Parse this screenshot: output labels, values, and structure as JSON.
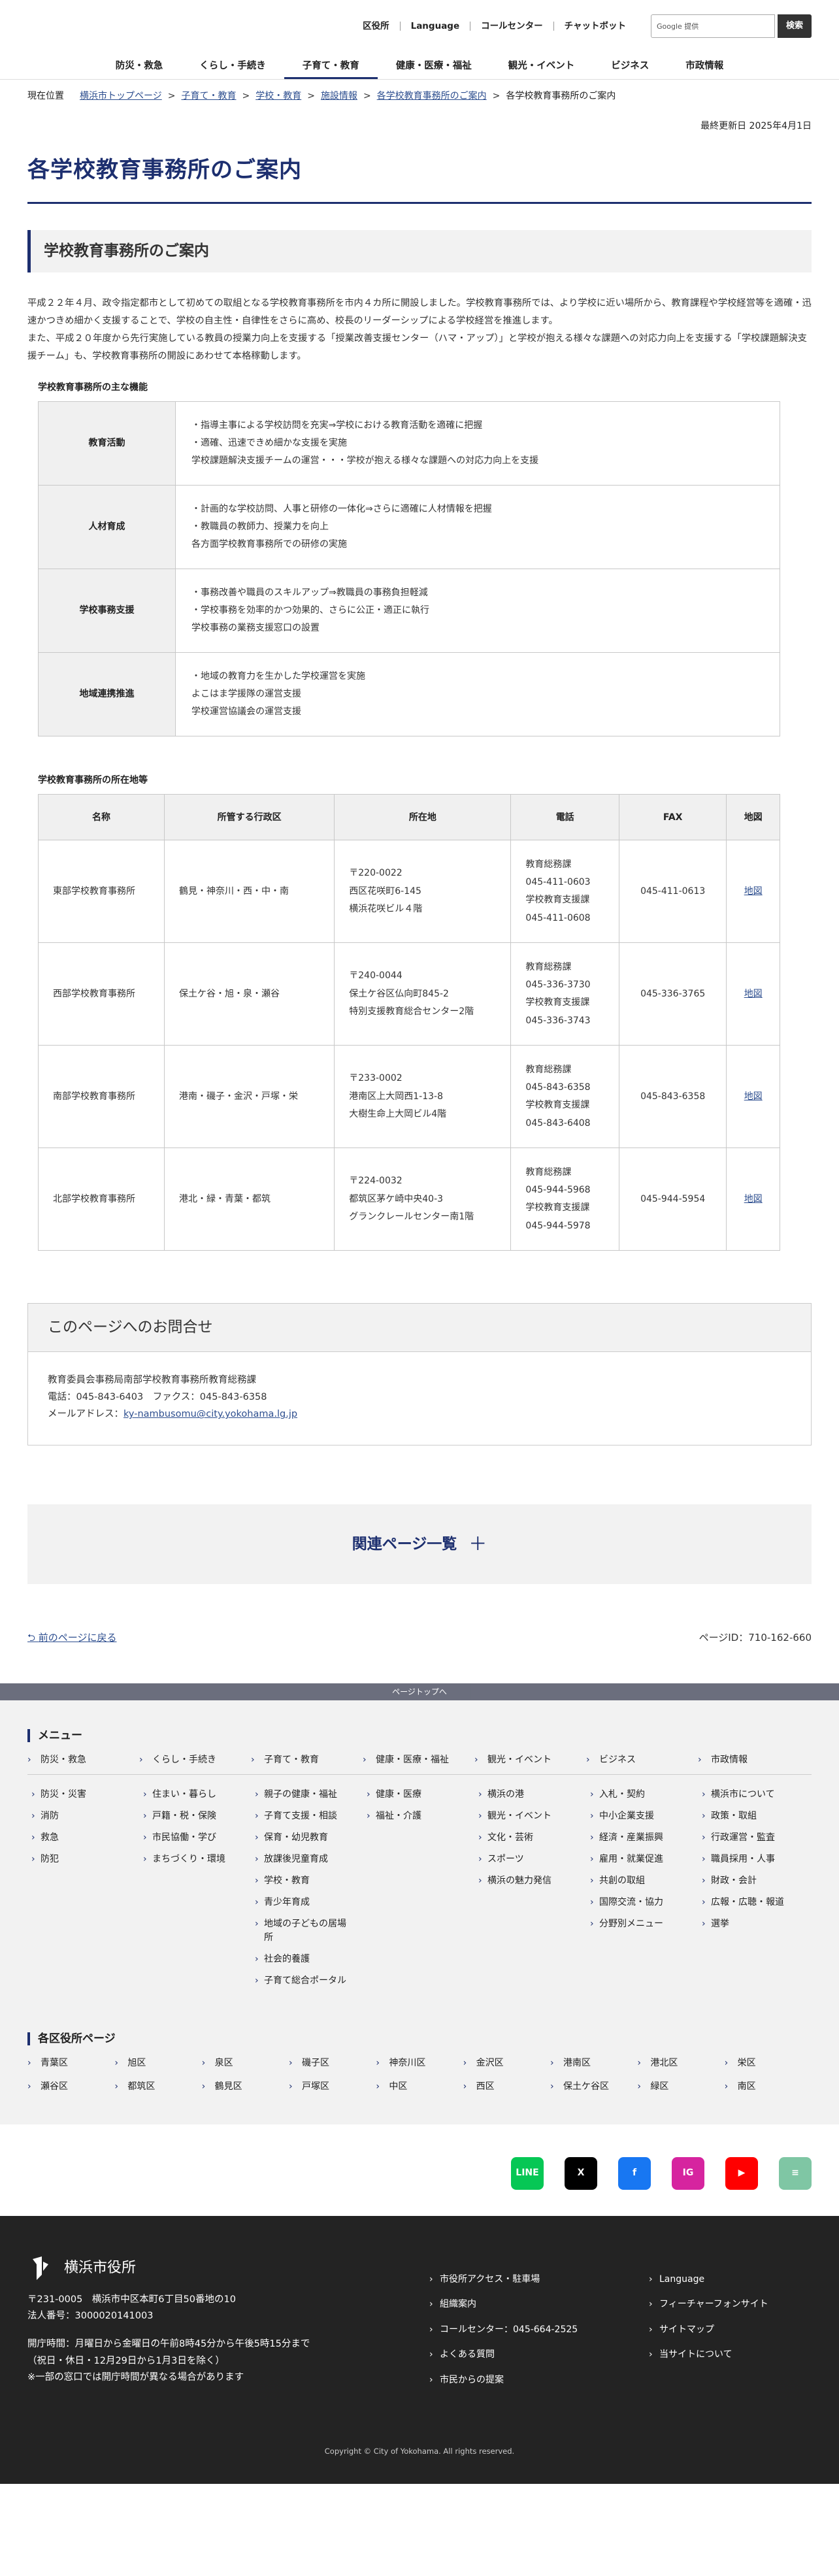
{
  "util": {
    "links": [
      "区役所",
      "Language",
      "コールセンター",
      "チャットボット"
    ],
    "search_placeholder": "Google 提供",
    "search_button": "検索"
  },
  "gnav": [
    "防災・救急",
    "くらし・手続き",
    "子育て・教育",
    "健康・医療・福祉",
    "観光・イベント",
    "ビジネス",
    "市政情報"
  ],
  "breadcrumb": {
    "label": "現在位置",
    "items": [
      "横浜市トップページ",
      "子育て・教育",
      "学校・教育",
      "施設情報",
      "各学校教育事務所のご案内"
    ],
    "current": "各学校教育事務所のご案内"
  },
  "updated": "最終更新日 2025年4月1日",
  "page_title": "各学校教育事務所のご案内",
  "section_title": "学校教育事務所のご案内",
  "intro": [
    "平成２２年４月、政令指定都市として初めての取組となる学校教育事務所を市内４カ所に開設しました。学校教育事務所では、より学校に近い場所から、教育課程や学校経営等を適確・迅速かつきめ細かく支援することで、学校の自主性・自律性をさらに高め、校長のリーダーシップによる学校経営を推進します。",
    "また、平成２０年度から先行実施している教員の授業力向上を支援する「授業改善支援センター（ハマ・アップ）」と学校が抱える様々な課題への対応力向上を支援する「学校課題解決支援チーム」も、学校教育事務所の開設にあわせて本格稼動します。"
  ],
  "func_heading": "学校教育事務所の主な機能",
  "functions": [
    {
      "name": "教育活動",
      "lines": [
        "・指導主事による学校訪問を充実⇒学校における教育活動を適確に把握",
        "・適確、迅速できめ細かな支援を実施",
        "学校課題解決支援チームの運営・・・学校が抱える様々な課題への対応力向上を支援"
      ]
    },
    {
      "name": "人材育成",
      "lines": [
        "・計画的な学校訪問、人事と研修の一体化⇒さらに適確に人材情報を把握",
        "・教職員の教師力、授業力を向上",
        "各方面学校教育事務所での研修の実施"
      ]
    },
    {
      "name": "学校事務支援",
      "lines": [
        "・事務改善や職員のスキルアップ⇒教職員の事務負担軽減",
        "・学校事務を効率的かつ効果的、さらに公正・適正に執行",
        "学校事務の業務支援窓口の設置"
      ]
    },
    {
      "name": "地域連携推進",
      "lines": [
        "・地域の教育力を生かした学校運営を実施",
        "よこはま学援隊の運営支援",
        "学校運営協議会の運営支援"
      ]
    }
  ],
  "loc_heading": "学校教育事務所の所在地等",
  "loc_headers": [
    "名称",
    "所管する行政区",
    "所在地",
    "電話",
    "FAX",
    "地図"
  ],
  "offices": [
    {
      "name": "東部学校教育事務所",
      "wards": "鶴見・神奈川・西・中・南",
      "addr": [
        "〒220-0022",
        "西区花咲町6-145",
        "横浜花咲ビル４階"
      ],
      "tel": [
        "教育総務課",
        "045-411-0603",
        "学校教育支援課",
        "045-411-0608"
      ],
      "fax": "045-411-0613",
      "map": "地図"
    },
    {
      "name": "西部学校教育事務所",
      "wards": "保土ケ谷・旭・泉・瀬谷",
      "addr": [
        "〒240-0044",
        "保土ケ谷区仏向町845-2",
        "特別支援教育総合センター2階"
      ],
      "tel": [
        "教育総務課",
        "045-336-3730",
        "学校教育支援課",
        "045-336-3743"
      ],
      "fax": "045-336-3765",
      "map": "地図"
    },
    {
      "name": "南部学校教育事務所",
      "wards": "港南・磯子・金沢・戸塚・栄",
      "addr": [
        "〒233-0002",
        "港南区上大岡西1-13-8",
        "大樹生命上大岡ビル4階"
      ],
      "tel": [
        "教育総務課",
        "045-843-6358",
        "学校教育支援課",
        "045-843-6408"
      ],
      "fax": "045-843-6358",
      "map": "地図"
    },
    {
      "name": "北部学校教育事務所",
      "wards": "港北・緑・青葉・都筑",
      "addr": [
        "〒224-0032",
        "都筑区茅ケ崎中央40-3",
        "グランクレールセンター南1階"
      ],
      "tel": [
        "教育総務課",
        "045-944-5968",
        "学校教育支援課",
        "045-944-5978"
      ],
      "fax": "045-944-5954",
      "map": "地図"
    }
  ],
  "contact": {
    "title": "このページへのお問合せ",
    "dept": "教育委員会事務局南部学校教育事務所教育総務課",
    "tel": "電話：045-843-6403　ファクス：045-843-6358",
    "mail_label": "メールアドレス：",
    "mail": "ky-nambusomu@city.yokohama.lg.jp"
  },
  "related": {
    "label": "関連ページ一覧",
    "plus": "＋"
  },
  "back": "前のページに戻る",
  "page_id": "ページID：710-162-660",
  "page_top": "ページトップへ",
  "footer_menu": {
    "title": "メニュー",
    "cats": [
      "防災・救急",
      "くらし・手続き",
      "子育て・教育",
      "健康・医療・福祉",
      "観光・イベント",
      "ビジネス",
      "市政情報"
    ],
    "cols": [
      [
        "防災・災害",
        "消防",
        "救急",
        "防犯"
      ],
      [
        "住まい・暮らし",
        "戸籍・税・保険",
        "市民協働・学び",
        "まちづくり・環境"
      ],
      [
        "親子の健康・福祉",
        "子育て支援・相談",
        "保育・幼児教育",
        "放課後児童育成",
        "学校・教育",
        "青少年育成",
        "地域の子どもの居場所",
        "社会的養護",
        "子育て総合ポータル"
      ],
      [
        "健康・医療",
        "福祉・介護"
      ],
      [
        "横浜の港",
        "観光・イベント",
        "文化・芸術",
        "スポーツ",
        "横浜の魅力発信"
      ],
      [
        "入札・契約",
        "中小企業支援",
        "経済・産業振興",
        "雇用・就業促進",
        "共創の取組",
        "国際交流・協力",
        "分野別メニュー"
      ],
      [
        "横浜市について",
        "政策・取組",
        "行政運営・監査",
        "職員採用・人事",
        "財政・会計",
        "広報・広聴・報道",
        "選挙"
      ]
    ]
  },
  "wards": {
    "title": "各区役所ページ",
    "items": [
      "青葉区",
      "旭区",
      "泉区",
      "磯子区",
      "神奈川区",
      "金沢区",
      "港南区",
      "港北区",
      "栄区",
      "瀬谷区",
      "都筑区",
      "鶴見区",
      "戸塚区",
      "中区",
      "西区",
      "保土ケ谷区",
      "緑区",
      "南区"
    ]
  },
  "sns": [
    {
      "name": "LINE",
      "color": "#06c755"
    },
    {
      "name": "X",
      "color": "#000000"
    },
    {
      "name": "f",
      "color": "#1877f2"
    },
    {
      "name": "IG",
      "color": "#d6249f"
    },
    {
      "name": "▶",
      "color": "#ff0000"
    },
    {
      "name": "≡",
      "color": "#7fc6a4"
    }
  ],
  "footer": {
    "org": "横浜市役所",
    "addr1": "〒231-0005　横浜市中区本町6丁目50番地の10",
    "addr2": "法人番号：3000020141003",
    "hours1": "開庁時間：月曜日から金曜日の午前8時45分から午後5時15分まで",
    "hours2": "（祝日・休日・12月29日から1月3日を除く）",
    "hours3": "※一部の窓口では開庁時間が異なる場合があります",
    "links1": [
      "市役所アクセス・駐車場",
      "組織案内",
      "コールセンター：045-664-2525",
      "よくある質問",
      "市民からの提案"
    ],
    "links2": [
      "Language",
      "フィーチャーフォンサイト",
      "サイトマップ",
      "当サイトについて"
    ],
    "copyright": "Copyright © City of Yokohama. All rights reserved."
  }
}
